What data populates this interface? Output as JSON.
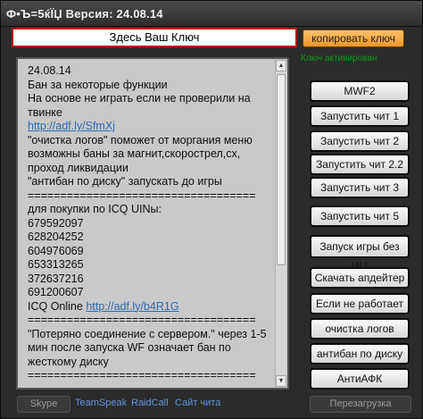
{
  "window": {
    "title": "Ф•Ъ=5ќЇЏ Версия: 24.08.14"
  },
  "key": {
    "value": "Здесь Ваш Ключ",
    "copy_label": "копировать ключ",
    "status": "Ключ активирован"
  },
  "log": {
    "lines": [
      {
        "text": "24.08.14",
        "link": false
      },
      {
        "text": "Бан за некоторые функции",
        "link": false
      },
      {
        "text": "На основе не играть если не проверили на",
        "link": false
      },
      {
        "text": "твинке",
        "link": false
      },
      {
        "text": "http://adf.ly/SfmXj",
        "link": true
      },
      {
        "text": "\"очистка логов\" поможет от моргания меню",
        "link": false
      },
      {
        "text": "возможны баны за магнит,скорострел,сх,",
        "link": false
      },
      {
        "text": "проход ликвидации",
        "link": false
      },
      {
        "text": "\"антибан по диску\" запускать до игры",
        "link": false
      },
      {
        "text": "===================================",
        "link": false
      },
      {
        "text": "для покупки по ICQ UINы:",
        "link": false
      },
      {
        "text": "679592097",
        "link": false
      },
      {
        "text": "628204252",
        "link": false
      },
      {
        "text": "604976069",
        "link": false
      },
      {
        "text": "653313265",
        "link": false
      },
      {
        "text": "372637216",
        "link": false
      },
      {
        "text": "691200607",
        "link": false
      },
      {
        "text": "ICQ Online ",
        "link": false,
        "suffix_link": "http://adf.ly/b4R1G"
      },
      {
        "text": "===================================",
        "link": false
      },
      {
        "text": "\"Потеряно соединение с сервером.\" через 1-5",
        "link": false
      },
      {
        "text": "мин после запуска WF означает бан по",
        "link": false
      },
      {
        "text": "жесткому диску",
        "link": false
      },
      {
        "text": "===================================",
        "link": false
      }
    ]
  },
  "buttons": {
    "mwf2": "MWF2",
    "cheat1": "Запустить чит 1",
    "cheat2": "Запустить чит 2",
    "cheat22": "Запустить чит 2.2",
    "cheat3": "Запустить чит 3",
    "cheat5": "Запустить чит 5",
    "launch_no_ic": "Запуск игры без ИЦ",
    "download_updater": "Скачать апдейтер",
    "if_not_working": "Если не работает",
    "clear_logs": "очистка логов",
    "antiban_disk": "антибан по диску",
    "antiafk": "АнтиАФК"
  },
  "footer": {
    "skype": "Skype",
    "teamspeak": "TeamSpeak",
    "raidcall": "RaidCall",
    "site": "Сайт чита",
    "reload": "Перезагрузка"
  }
}
